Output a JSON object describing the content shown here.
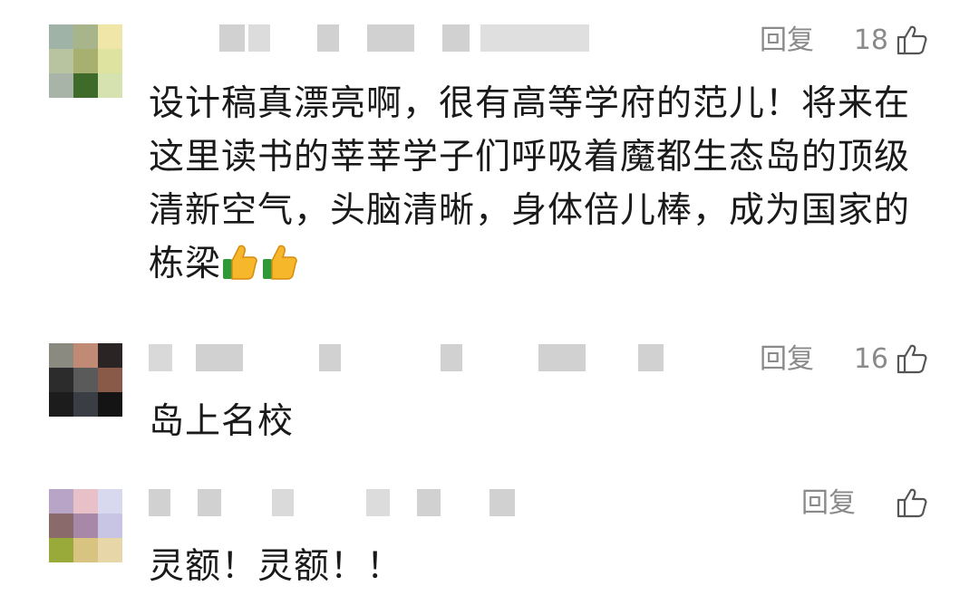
{
  "comments": [
    {
      "reply_label": "回复",
      "like_count": "18",
      "text": "设计稿真漂亮啊，很有高等学府的范儿！将来在这里读书的莘莘学子们呼吸着魔都生态岛的顶级清新空气，头脑清晰，身体倍儿棒，成为国家的栋梁",
      "emojis": [
        "thumbs-up-emoji",
        "thumbs-up-emoji"
      ],
      "avatar_colors": [
        "#9fb4a6",
        "#a8b48a",
        "#efe6a8",
        "#b8c4a0",
        "#a8b070",
        "#dfe3a0",
        "#a8b4a8",
        "#3e6a2a",
        "#d6e2b0"
      ]
    },
    {
      "reply_label": "回复",
      "like_count": "16",
      "text": "岛上名校",
      "avatar_colors": [
        "#8a8a80",
        "#c08a74",
        "#2a2424",
        "#2c2c2c",
        "#5a5a5a",
        "#8a5a48",
        "#1c1c1c",
        "#3a3e44",
        "#141414"
      ]
    },
    {
      "reply_label": "回复",
      "like_count": "",
      "text": "灵额！灵额！！",
      "avatar_colors": [
        "#b8a4c6",
        "#e8c0c8",
        "#d8d8ee",
        "#8a6a6a",
        "#a888a8",
        "#c8c4e4",
        "#9aaa3a",
        "#d8c480",
        "#e6d6a8"
      ]
    }
  ]
}
